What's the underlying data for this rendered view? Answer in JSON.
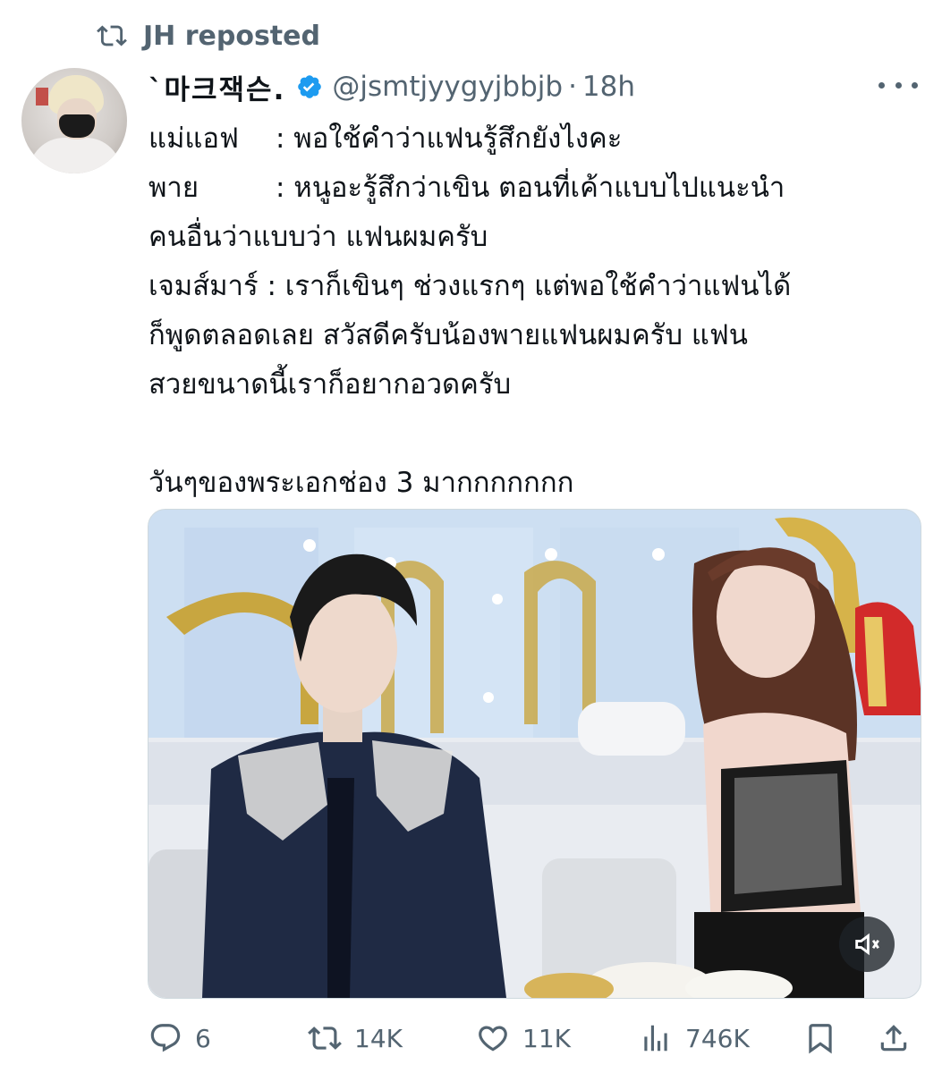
{
  "repost_banner": {
    "text": "JH reposted"
  },
  "author": {
    "display_name": "`마크잭슨.",
    "handle": "@jsmtjyygyjbbjb",
    "separator": "·",
    "time": "18h",
    "verified": true
  },
  "tweet": {
    "lines": [
      {
        "speaker": "แม่แอฟ",
        "text": ": พอใช้คำว่าแฟนรู้สึกยังไงคะ"
      },
      {
        "speaker": "พาย",
        "text": ": หนูอะรู้สึกว่าเขิน ตอนที่เค้าแบบไปแนะนำ"
      },
      {
        "speaker": "",
        "text": "คนอื่นว่าแบบว่า แฟนผมครับ"
      },
      {
        "speaker": "",
        "text": "เจมส์มาร์ : เราก็เขินๆ ช่วงแรกๆ แต่พอใช้คำว่าแฟนได้"
      },
      {
        "speaker": "",
        "text": "ก็พูดตลอดเลย สวัสดีครับน้องพายแฟนผมครับ แฟน"
      },
      {
        "speaker": "",
        "text": "สวยขนาดนี้เราก็อยากอวดครับ"
      },
      {
        "speaker": "",
        "text": ""
      },
      {
        "speaker": "",
        "text": "วันๆของพระเอกช่อง 3 มากกกกกกก"
      }
    ]
  },
  "media": {
    "type": "video",
    "mute_icon": "speaker-muted-icon"
  },
  "actions": {
    "reply_count": "6",
    "repost_count": "14K",
    "like_count": "11K",
    "view_count": "746K"
  },
  "colors": {
    "text": "#0f1419",
    "secondary": "#536471",
    "verified": "#1d9bf0"
  }
}
